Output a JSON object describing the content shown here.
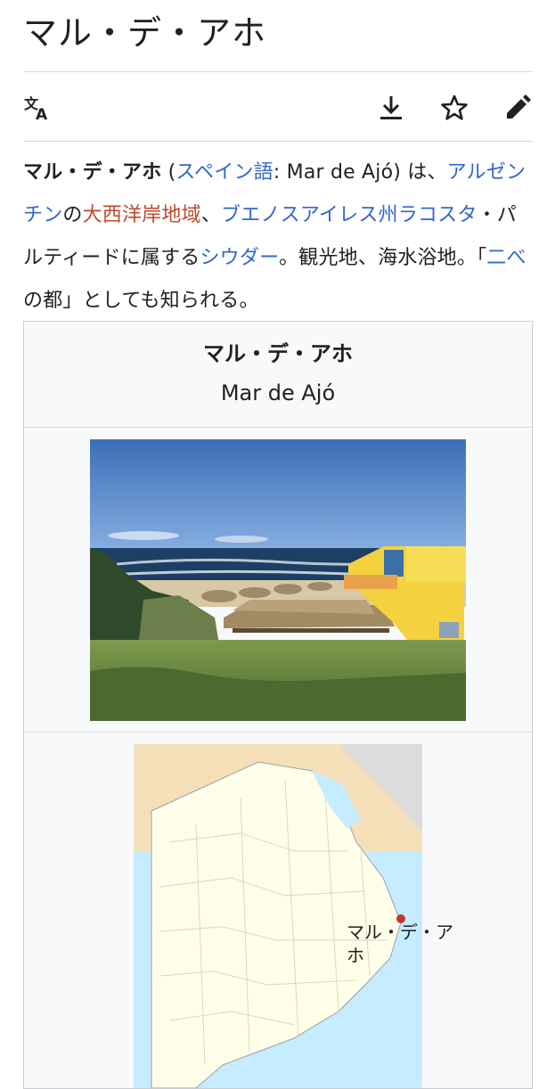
{
  "page": {
    "title": "マル・デ・アホ"
  },
  "toolbar": {
    "language_icon": "translate-icon",
    "download_icon": "download-icon",
    "watch_icon": "star-icon",
    "edit_icon": "pencil-icon"
  },
  "lead": {
    "bold_name": "マル・デ・アホ",
    "t1": " (",
    "link_spanish": "スペイン語",
    "t2": ": Mar de Ajó) は、",
    "link_argentina": "アルゼンチン",
    "t3": "の",
    "link_atlantic": "大西洋岸地域",
    "t4": "、",
    "link_province": "ブエノスアイレス州ラコスタ",
    "t5": "・パルティードに属する",
    "link_city": "シウダー",
    "t6": "。観光地、海水浴地。「",
    "link_nibe": "二べ",
    "t7": "の都」としても知られる。"
  },
  "infobox": {
    "name": "マル・デ・アホ",
    "native_name": "Mar de Ajó",
    "map_label": "マル・デ・アホ"
  },
  "colors": {
    "link": "#3366cc",
    "redlink": "#ba4a2c",
    "text": "#202122",
    "border": "#c8ccd1",
    "infobox_bg": "#f8f9fa",
    "land": "#fefee9",
    "neighbor_land": "#f5dfb9",
    "sea": "#c6ecff",
    "marker": "#c0392b"
  }
}
